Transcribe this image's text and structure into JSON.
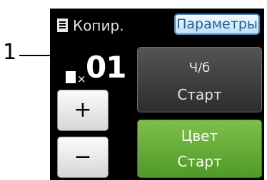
{
  "callout": {
    "number": "1"
  },
  "header": {
    "mode_icon": "copy-document-icon",
    "mode_label": "Копир.",
    "options_tab": "Параметры"
  },
  "copies": {
    "icon": "copies-count-icon",
    "multiplier": "×",
    "value": "01"
  },
  "stepper": {
    "plus": "+",
    "minus": "−"
  },
  "buttons": {
    "bw_line1": "Ч/б",
    "bw_line2": "Старт",
    "color_line1": "Цвет",
    "color_line2": "Старт"
  },
  "colors": {
    "screen_bg": "#000000",
    "tab_border": "#4a84b8",
    "color_start": "#5fa832",
    "bw_start": "#3a3a3a"
  }
}
